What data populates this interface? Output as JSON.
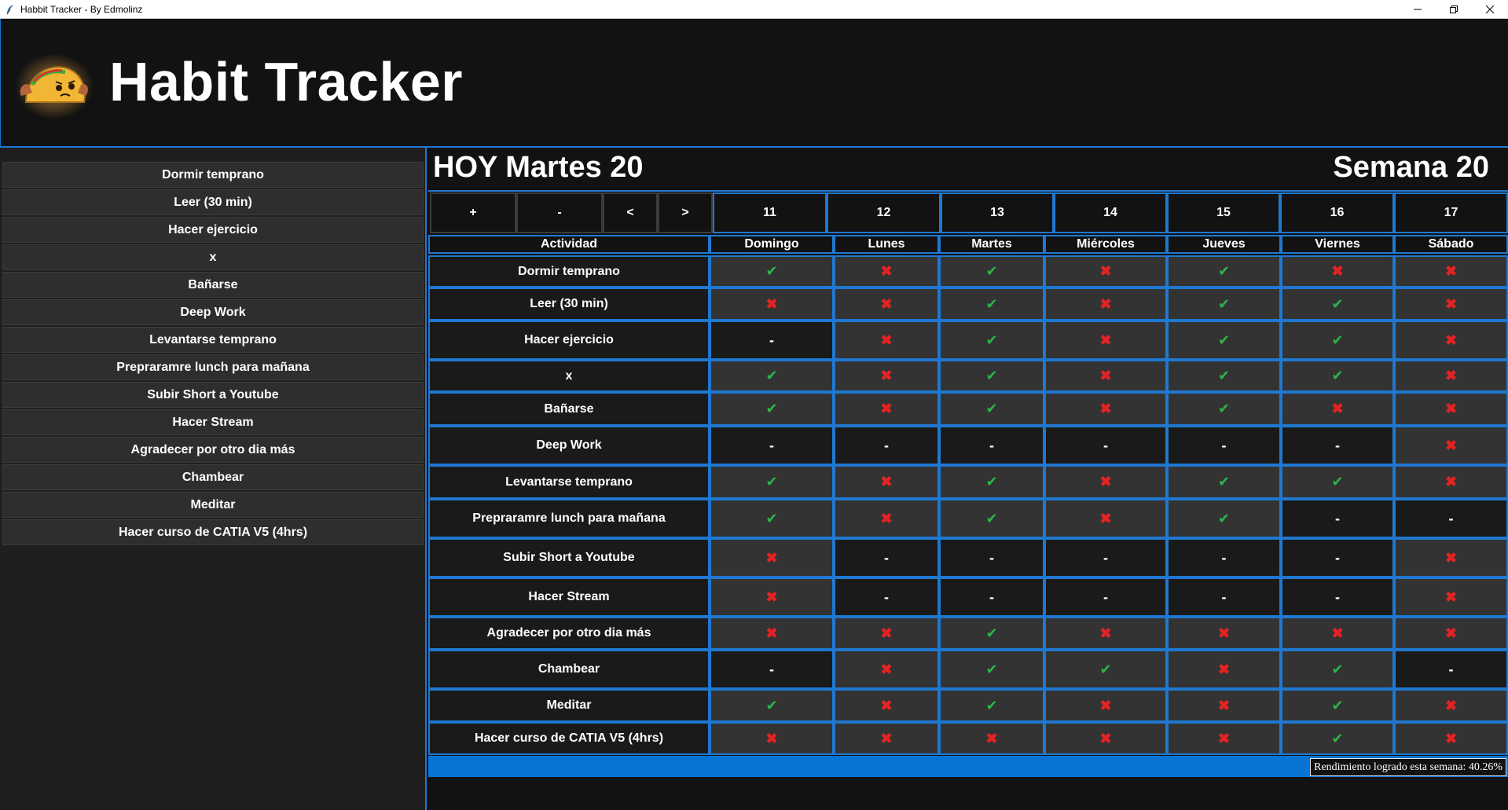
{
  "window": {
    "title": "Habbit Tracker - By Edmolinz",
    "controls": [
      "minimize",
      "restore",
      "close"
    ]
  },
  "header": {
    "title": "Habit Tracker",
    "logo": "taco-logo"
  },
  "sidebar": {
    "items": [
      "Dormir temprano",
      "Leer (30 min)",
      "Hacer ejercicio",
      "x",
      "Bañarse",
      "Deep Work",
      "Levantarse temprano",
      "Prepraramre lunch para mañana",
      "Subir Short a Youtube",
      "Hacer Stream",
      "Agradecer por otro dia más",
      "Chambear",
      "Meditar",
      "Hacer curso de CATIA V5 (4hrs)"
    ]
  },
  "main": {
    "today": "HOY Martes 20",
    "week": "Semana 20",
    "nav_buttons": [
      "+",
      "-",
      "<",
      ">"
    ],
    "day_numbers": [
      "11",
      "12",
      "13",
      "14",
      "15",
      "16",
      "17"
    ],
    "activity_header": "Actividad",
    "day_names": [
      "Domingo",
      "Lunes",
      "Martes",
      "Miércoles",
      "Jueves",
      "Viernes",
      "Sábado"
    ],
    "status_symbols": {
      "ok": "✔",
      "no": "✖",
      "na": "-"
    },
    "colors": {
      "ok": "#2fb34a",
      "no": "#e32323",
      "accent": "#1f78d1",
      "progress": "#0a74d4"
    },
    "rows": [
      {
        "activity": "Dormir temprano",
        "status": [
          "ok",
          "no",
          "ok",
          "no",
          "ok",
          "no",
          "no"
        ]
      },
      {
        "activity": "Leer (30 min)",
        "status": [
          "no",
          "no",
          "ok",
          "no",
          "ok",
          "ok",
          "no"
        ]
      },
      {
        "activity": "Hacer ejercicio",
        "status": [
          "na",
          "no",
          "ok",
          "no",
          "ok",
          "ok",
          "no"
        ]
      },
      {
        "activity": "x",
        "status": [
          "ok",
          "no",
          "ok",
          "no",
          "ok",
          "ok",
          "no"
        ]
      },
      {
        "activity": "Bañarse",
        "status": [
          "ok",
          "no",
          "ok",
          "no",
          "ok",
          "no",
          "no"
        ]
      },
      {
        "activity": "Deep Work",
        "status": [
          "na",
          "na",
          "na",
          "na",
          "na",
          "na",
          "no"
        ]
      },
      {
        "activity": "Levantarse temprano",
        "status": [
          "ok",
          "no",
          "ok",
          "no",
          "ok",
          "ok",
          "no"
        ]
      },
      {
        "activity": "Prepraramre lunch para mañana",
        "status": [
          "ok",
          "no",
          "ok",
          "no",
          "ok",
          "na",
          "na"
        ]
      },
      {
        "activity": "Subir Short a Youtube",
        "status": [
          "no",
          "na",
          "na",
          "na",
          "na",
          "na",
          "no"
        ]
      },
      {
        "activity": "Hacer Stream",
        "status": [
          "no",
          "na",
          "na",
          "na",
          "na",
          "na",
          "no"
        ]
      },
      {
        "activity": "Agradecer por otro dia más",
        "status": [
          "no",
          "no",
          "ok",
          "no",
          "no",
          "no",
          "no"
        ]
      },
      {
        "activity": "Chambear",
        "status": [
          "na",
          "no",
          "ok",
          "ok",
          "no",
          "ok",
          "na"
        ]
      },
      {
        "activity": "Meditar",
        "status": [
          "ok",
          "no",
          "ok",
          "no",
          "no",
          "ok",
          "no"
        ]
      },
      {
        "activity": "Hacer curso de CATIA V5 (4hrs)",
        "status": [
          "no",
          "no",
          "no",
          "no",
          "no",
          "ok",
          "no"
        ]
      }
    ],
    "progress": {
      "percent": 40.26,
      "label": "Rendimiento logrado esta semana: 40.26%"
    }
  }
}
